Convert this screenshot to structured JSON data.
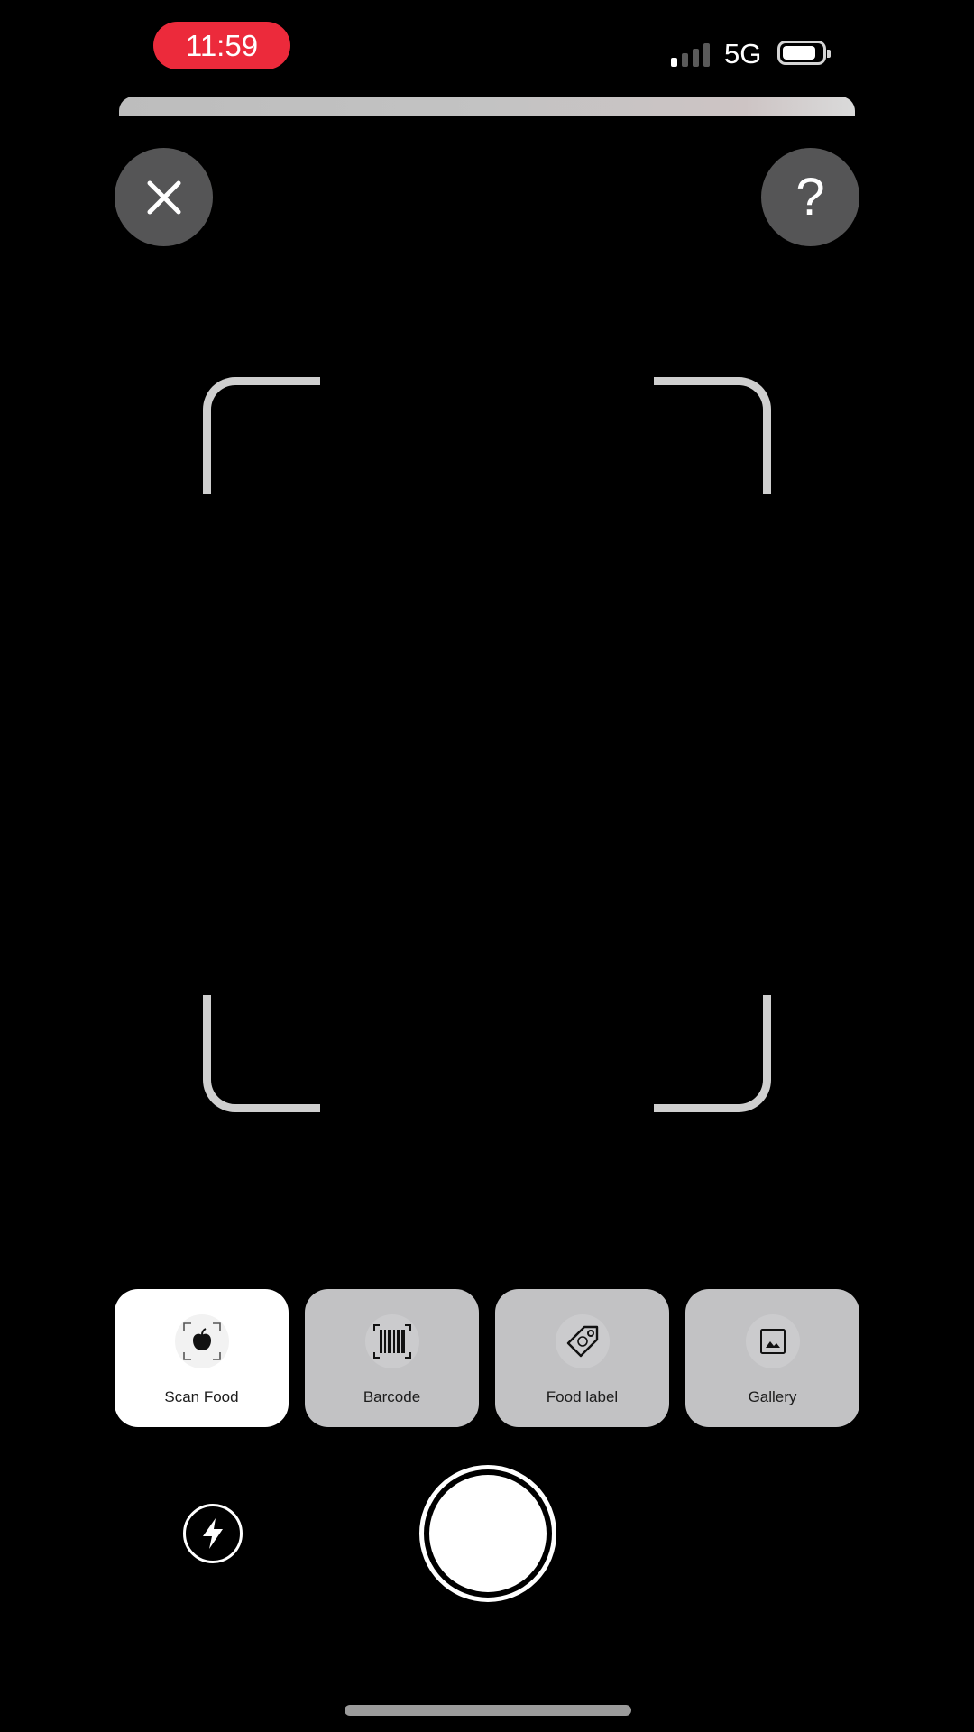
{
  "status_bar": {
    "time": "11:59",
    "network": "5G",
    "signal_bars_active": 1,
    "signal_bars_total": 4,
    "battery_level": 0.8,
    "time_pill_color": "#ec2a3b"
  },
  "camera": {
    "close_icon": "close-icon",
    "help_label": "?"
  },
  "mode_tabs": [
    {
      "label": "Scan Food",
      "icon": "apple-scan-icon",
      "active": true
    },
    {
      "label": "Barcode",
      "icon": "barcode-icon",
      "active": false
    },
    {
      "label": "Food label",
      "icon": "tag-icon",
      "active": false
    },
    {
      "label": "Gallery",
      "icon": "image-icon",
      "active": false
    }
  ],
  "controls": {
    "flash_icon": "lightning-icon",
    "shutter_icon": "shutter-button"
  }
}
